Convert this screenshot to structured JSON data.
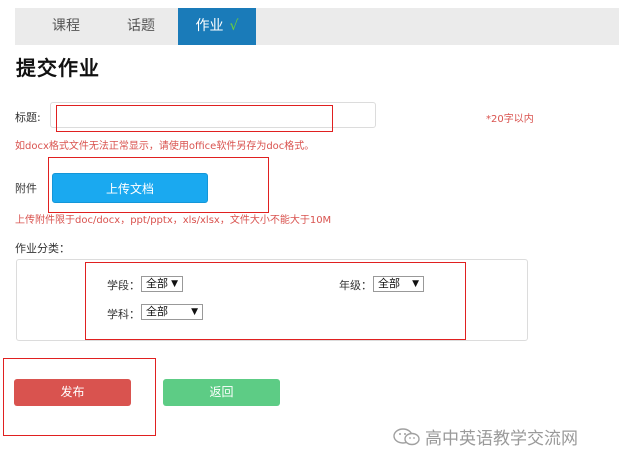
{
  "tabs": [
    {
      "label": "课程"
    },
    {
      "label": "话题"
    },
    {
      "label": "作业",
      "active": true,
      "check": "√"
    }
  ],
  "page_title": "提交作业",
  "title_field": {
    "label": "标题:",
    "value": "",
    "limit_hint": "*20字以内"
  },
  "docx_notice": "如docx格式文件无法正常显示，请使用office软件另存为doc格式。",
  "attachment": {
    "label": "附件",
    "upload_label": "上传文档",
    "hint": "上传附件限于doc/docx，ppt/pptx，xls/xlsx，文件大小不能大于10M"
  },
  "category": {
    "label": "作业分类：",
    "stage": {
      "label": "学段：",
      "selected": "全部"
    },
    "grade": {
      "label": "年级：",
      "selected": "全部"
    },
    "subject": {
      "label": "学科：",
      "selected": "全部"
    }
  },
  "buttons": {
    "publish": "发布",
    "back": "返回"
  },
  "watermark": "高中英语教学交流网",
  "colors": {
    "tab_active": "#1a7bb9",
    "upload": "#1aa9f0",
    "publish": "#d9534f",
    "back": "#5dcc85",
    "hint_red": "#d9534f",
    "annotation_red": "#e02020"
  },
  "icons": {
    "dropdown": "triangle-down",
    "watermark": "wechat-icon"
  }
}
